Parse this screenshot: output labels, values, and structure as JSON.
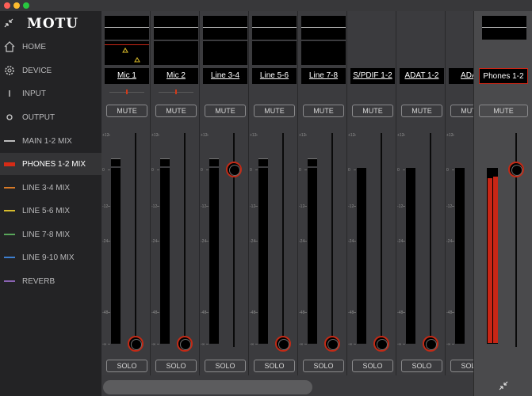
{
  "app": {
    "logo": "MOTU"
  },
  "sidebar": {
    "items": [
      {
        "label": "HOME",
        "icon": "house-icon",
        "active": false
      },
      {
        "label": "DEVICE",
        "icon": "gear-icon",
        "active": false
      },
      {
        "label": "INPUT",
        "icon": "input-bar-icon",
        "active": false
      },
      {
        "label": "OUTPUT",
        "icon": "output-circle-icon",
        "active": false
      },
      {
        "label": "MAIN 1-2 MIX",
        "color": "#bcbcbc",
        "active": false
      },
      {
        "label": "PHONES 1-2 MIX",
        "color": "#d62b16",
        "active": true
      },
      {
        "label": "LINE 3-4 MIX",
        "color": "#d87a27",
        "active": false
      },
      {
        "label": "LINE 5-6 MIX",
        "color": "#d6bb2d",
        "active": false
      },
      {
        "label": "LINE 7-8 MIX",
        "color": "#58a65a",
        "active": false
      },
      {
        "label": "LINE 9-10 MIX",
        "color": "#3d7fd0",
        "active": false
      },
      {
        "label": "REVERB",
        "color": "#8a63b3",
        "active": false
      }
    ]
  },
  "mixer": {
    "mute_label": "MUTE",
    "solo_label": "SOLO",
    "scale": [
      "+12",
      "0",
      "-12",
      "-24",
      "-48",
      "-∞"
    ],
    "channels": [
      {
        "name": "Mic 1"
      },
      {
        "name": "Mic 2"
      },
      {
        "name": "Line 3-4"
      },
      {
        "name": "Line 5-6"
      },
      {
        "name": "Line 7-8"
      },
      {
        "name": "S/PDIF 1-2"
      },
      {
        "name": "ADAT 1-2"
      },
      {
        "name": "ADAT"
      }
    ],
    "output": {
      "name": "Phones 1-2"
    }
  }
}
